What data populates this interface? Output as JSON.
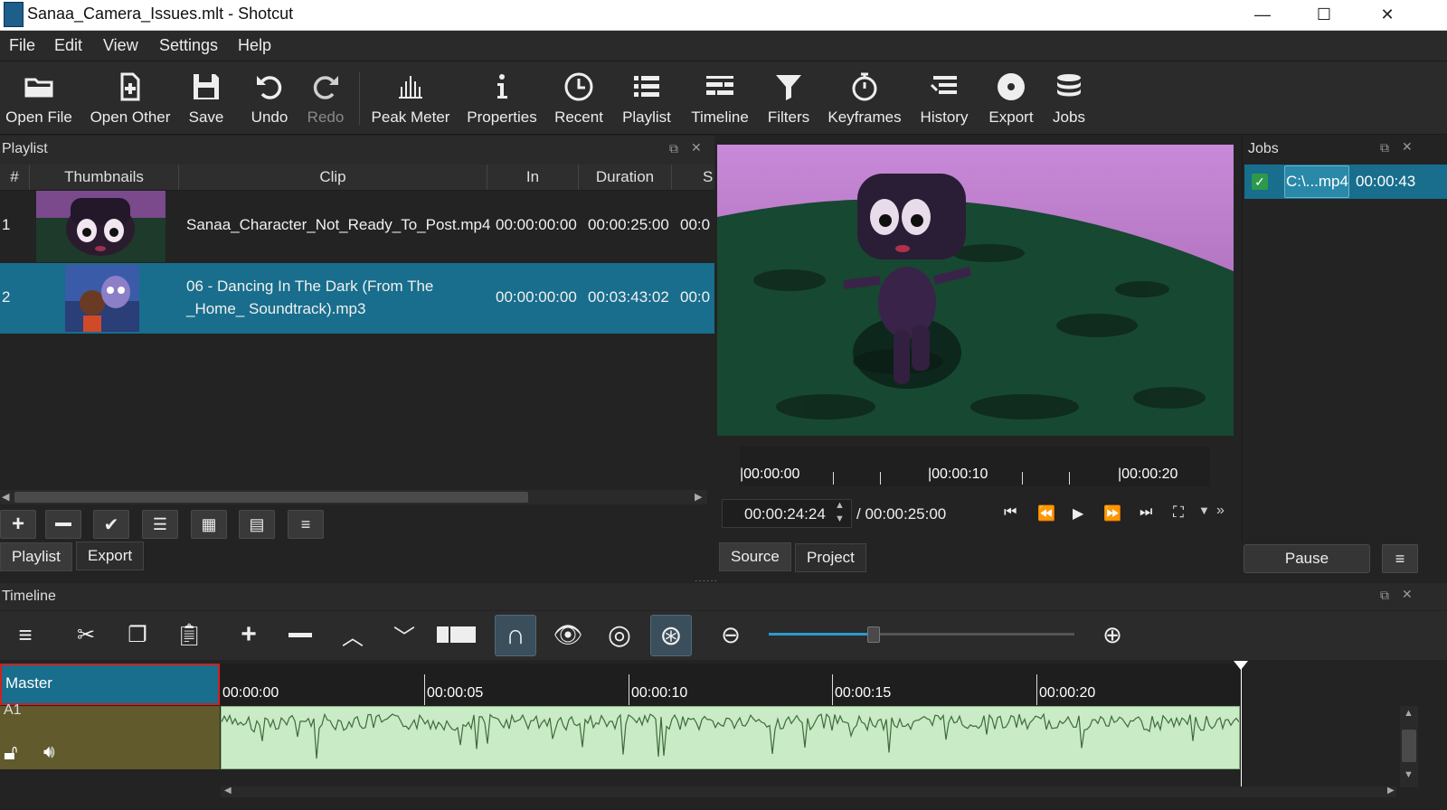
{
  "window": {
    "title": "Sanaa_Camera_Issues.mlt - Shotcut",
    "minimize": "—",
    "maximize": "☐",
    "close": "✕"
  },
  "menu": [
    "File",
    "Edit",
    "View",
    "Settings",
    "Help"
  ],
  "toolbar": [
    {
      "label": "Open File",
      "icon": "folder-open-icon"
    },
    {
      "label": "Open Other",
      "icon": "open-other-icon"
    },
    {
      "label": "Save",
      "icon": "save-icon"
    },
    {
      "label": "Undo",
      "icon": "undo-icon"
    },
    {
      "label": "Redo",
      "icon": "redo-icon",
      "disabled": true
    },
    {
      "label": "Peak Meter",
      "icon": "peak-meter-icon"
    },
    {
      "label": "Properties",
      "icon": "info-icon"
    },
    {
      "label": "Recent",
      "icon": "clock-icon"
    },
    {
      "label": "Playlist",
      "icon": "list-icon"
    },
    {
      "label": "Timeline",
      "icon": "timeline-icon"
    },
    {
      "label": "Filters",
      "icon": "funnel-icon"
    },
    {
      "label": "Keyframes",
      "icon": "stopwatch-icon"
    },
    {
      "label": "History",
      "icon": "history-icon"
    },
    {
      "label": "Export",
      "icon": "export-disc-icon"
    },
    {
      "label": "Jobs",
      "icon": "jobs-stack-icon"
    }
  ],
  "playlist": {
    "title": "Playlist",
    "columns": [
      "#",
      "Thumbnails",
      "Clip",
      "In",
      "Duration",
      "S"
    ],
    "rows": [
      {
        "num": "1",
        "clip": "Sanaa_Character_Not_Ready_To_Post.mp4",
        "clip2": "",
        "in": "00:00:00:00",
        "duration": "00:00:25:00",
        "start": "00:0"
      },
      {
        "num": "2",
        "clip": "06 - Dancing In The Dark (From The",
        "clip2": "_Home_ Soundtrack).mp3",
        "in": "00:00:00:00",
        "duration": "00:03:43:02",
        "start": "00:0"
      }
    ],
    "tabs": [
      "Playlist",
      "Export"
    ]
  },
  "player": {
    "ruler": [
      "|00:00:00",
      "|00:00:10",
      "|00:00:20"
    ],
    "position": "00:00:24:24",
    "duration": "/ 00:00:25:00",
    "tabs": [
      "Source",
      "Project"
    ]
  },
  "jobs": {
    "title": "Jobs",
    "job_name": "C:\\...mp4",
    "job_time": "00:00:43",
    "pause": "Pause"
  },
  "timeline": {
    "title": "Timeline",
    "master": "Master",
    "track": "A1",
    "ruler": [
      "00:00:00",
      "00:00:05",
      "00:00:10",
      "00:00:15",
      "00:00:20"
    ],
    "zoom_level": 0.34
  },
  "colors": {
    "accent": "#1a6e8e",
    "waveform_bg": "#c9ebc5",
    "track_head": "#605a2c"
  }
}
